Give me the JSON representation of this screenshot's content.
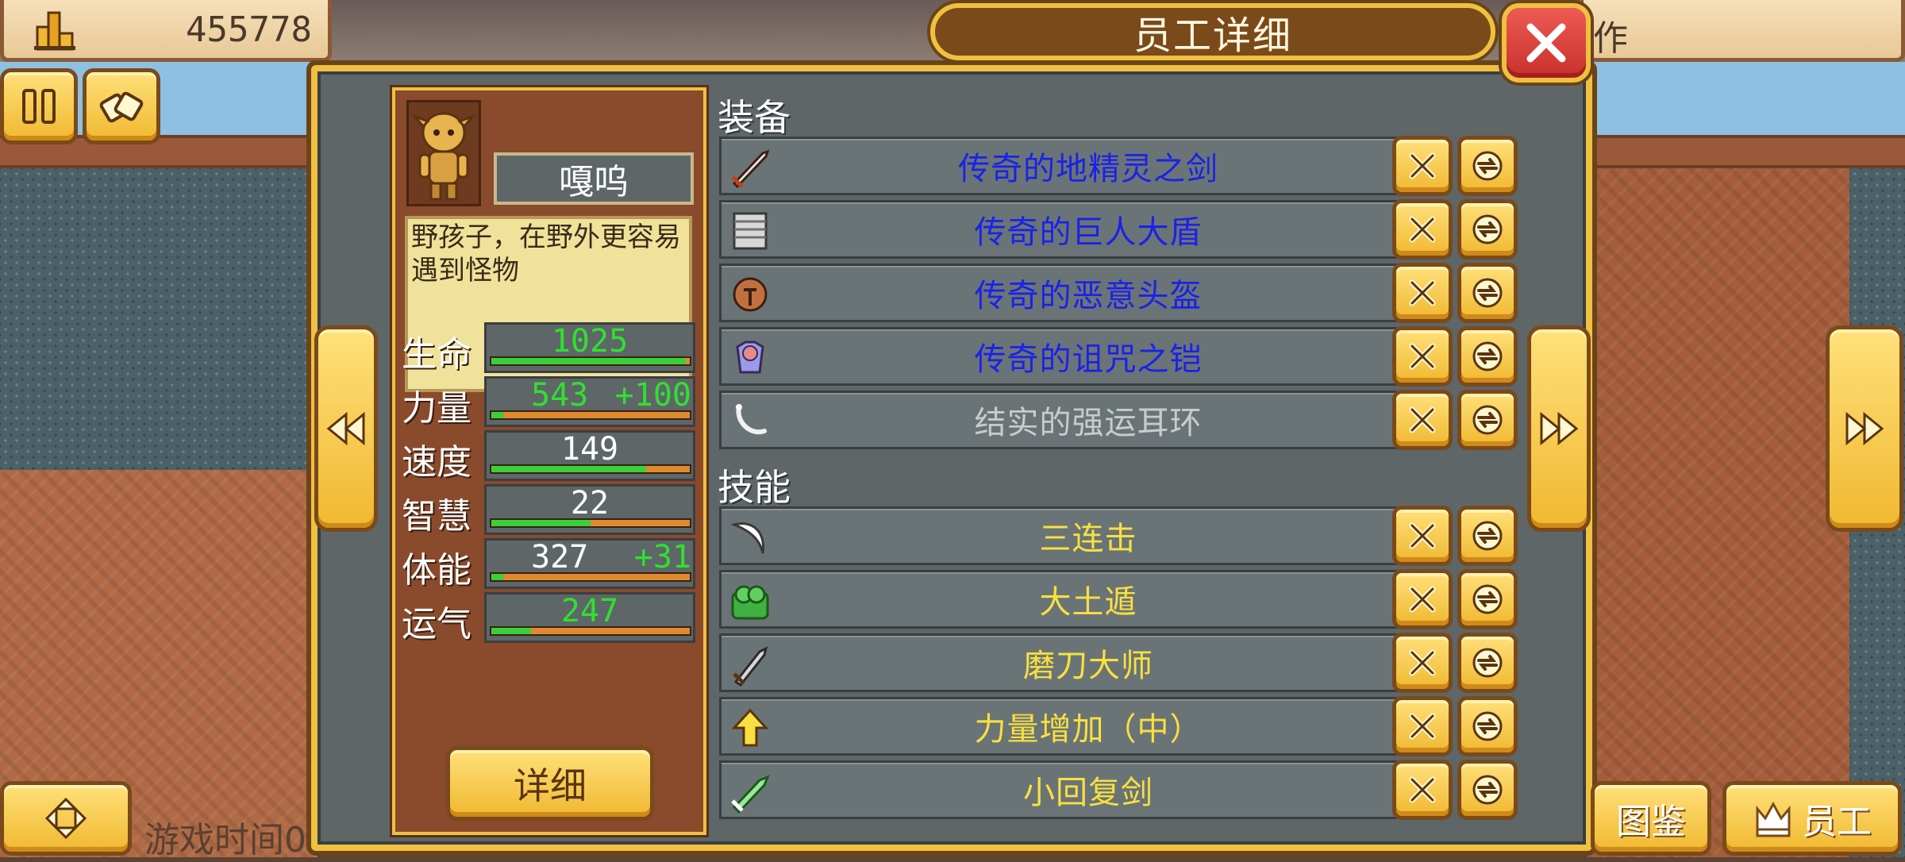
{
  "hud": {
    "coins": "455778",
    "top_right_text": "作",
    "game_time_text": "游戏时间0"
  },
  "dialog": {
    "title": "员工详细"
  },
  "character": {
    "name": "嘎呜",
    "description": "野孩子，在野外更容易遇到怪物",
    "detail_button": "详细",
    "stats": [
      {
        "label": "生命",
        "value": "1025",
        "bonus": "",
        "value_color": "#30e030",
        "fill": 0.98
      },
      {
        "label": "力量",
        "value": "543",
        "bonus": "+100",
        "value_color": "#30e030",
        "fill": 0.06
      },
      {
        "label": "速度",
        "value": "149",
        "bonus": "",
        "value_color": "#ffffff",
        "fill": 0.78
      },
      {
        "label": "智慧",
        "value": "22",
        "bonus": "",
        "value_color": "#ffffff",
        "fill": 0.5
      },
      {
        "label": "体能",
        "value": "327",
        "bonus": "+31",
        "value_color": "#ffffff",
        "fill": 0.06
      },
      {
        "label": "运气",
        "value": "247",
        "bonus": "",
        "value_color": "#30e030",
        "fill": 0.2
      }
    ]
  },
  "equipment": {
    "title": "装备",
    "items": [
      {
        "name": "传奇的地精灵之剑",
        "color": "#1a22e8",
        "icon": "sword-icon"
      },
      {
        "name": "传奇的巨人大盾",
        "color": "#1a22e8",
        "icon": "shield-icon"
      },
      {
        "name": "传奇的恶意头盔",
        "color": "#1a22e8",
        "icon": "helmet-icon"
      },
      {
        "name": "传奇的诅咒之铠",
        "color": "#1a22e8",
        "icon": "armor-icon"
      },
      {
        "name": "结实的强运耳环",
        "color": "#c8cccc",
        "icon": "earring-icon"
      }
    ]
  },
  "skills": {
    "title": "技能",
    "items": [
      {
        "name": "三连击",
        "color": "#f8e040",
        "icon": "triple-strike-icon"
      },
      {
        "name": "大土遁",
        "color": "#f8e040",
        "icon": "earth-escape-icon"
      },
      {
        "name": "磨刀大师",
        "color": "#f8e040",
        "icon": "blade-master-icon"
      },
      {
        "name": "力量增加（中）",
        "color": "#f8e040",
        "icon": "strength-up-icon"
      },
      {
        "name": "小回复剑",
        "color": "#f8e040",
        "icon": "heal-sword-icon"
      }
    ]
  },
  "bottom_tabs": {
    "encyclopedia": "图鉴",
    "staff": "员工"
  }
}
